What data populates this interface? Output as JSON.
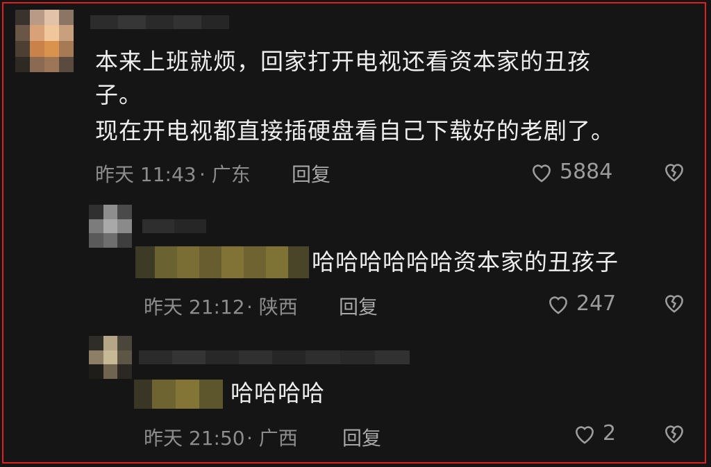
{
  "comments": [
    {
      "text_lines": [
        "本来上班就烦，回家打开电视还看资本家的丑孩",
        "子。",
        "现在开电视都直接插硬盘看自己下载好的老剧了。"
      ],
      "time": "昨天 11:43",
      "location": "· 广东",
      "reply_label": "回复",
      "likes": "5884"
    },
    {
      "text": "哈哈哈哈哈哈资本家的丑孩子",
      "time": "昨天 21:12",
      "location": "· 陕西",
      "reply_label": "回复",
      "likes": "247"
    },
    {
      "text": "哈哈哈哈",
      "time": "昨天 21:50",
      "location": "· 广西",
      "reply_label": "回复",
      "likes": "2"
    }
  ],
  "icons": {
    "like": "heart-outline-icon",
    "dislike": "broken-heart-icon"
  },
  "colors": {
    "background": "#151515",
    "border": "#e0201f",
    "text": "#eeeeee",
    "meta": "#8d8d8d"
  }
}
